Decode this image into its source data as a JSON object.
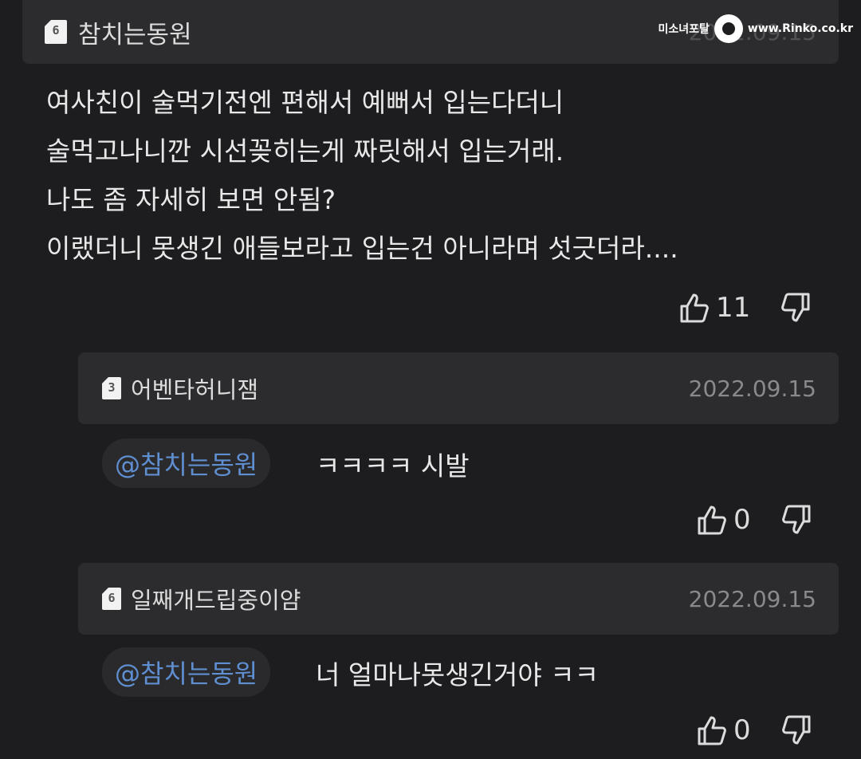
{
  "watermark": {
    "left_text": "미소녀포탈",
    "right_text": "www.Rinko.co.kr"
  },
  "post": {
    "level": "6",
    "author": "참치는동원",
    "date": "2022.09.15",
    "lines": [
      "여사친이 술먹기전엔 편해서 예뻐서 입는다더니",
      "술먹고나니깐 시선꽂히는게 짜릿해서 입는거래.",
      "나도 좀 자세히 보면 안됨?",
      "이랬더니 못생긴 애들보라고 입는건 아니라며 섯긋더라...."
    ],
    "likes": "11"
  },
  "replies": [
    {
      "level": "3",
      "author": "어벤타허니잼",
      "date": "2022.09.15",
      "mention": "@참치는동원",
      "text": "ㅋㅋㅋㅋ 시발",
      "likes": "0"
    },
    {
      "level": "6",
      "author": "일째개드립중이얌",
      "date": "2022.09.15",
      "mention": "@참치는동원",
      "text": "너 얼마나못생긴거야 ㅋㅋ",
      "likes": "0"
    }
  ],
  "icons": {
    "like": "thumbs-up-icon",
    "dislike": "thumbs-down-icon",
    "level": "level-badge-icon"
  }
}
